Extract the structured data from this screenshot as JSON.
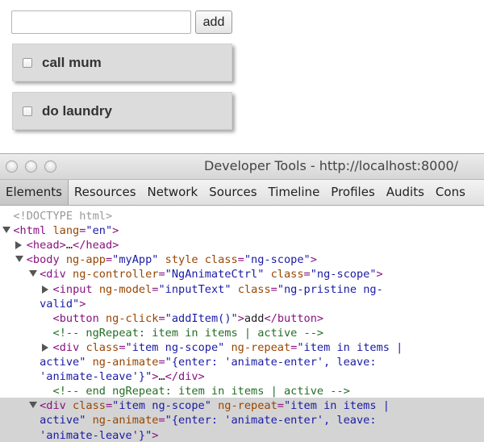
{
  "app": {
    "input": {
      "value": "",
      "placeholder": ""
    },
    "add_label": "add",
    "items": [
      {
        "label": "call mum",
        "checked": false
      },
      {
        "label": "do laundry",
        "checked": false
      }
    ]
  },
  "devtools": {
    "window_title": "Developer Tools - http://localhost:8000/",
    "tabs": [
      "Elements",
      "Resources",
      "Network",
      "Sources",
      "Timeline",
      "Profiles",
      "Audits",
      "Cons"
    ],
    "active_tab": "Elements",
    "tree": [
      {
        "indent": 2,
        "toggle": null,
        "parts": [
          [
            "c-doctype",
            "<!DOCTYPE html>"
          ]
        ]
      },
      {
        "indent": 2,
        "toggle": "down",
        "parts": [
          [
            "c-tag",
            "<html "
          ],
          [
            "c-attr",
            "lang"
          ],
          [
            "c-tag",
            "="
          ],
          [
            "c-val",
            "\"en\""
          ],
          [
            "c-tag",
            ">"
          ]
        ]
      },
      {
        "indent": 4,
        "toggle": "right",
        "parts": [
          [
            "c-tag",
            "<head>"
          ],
          [
            "c-text",
            "…"
          ],
          [
            "c-tag",
            "</head>"
          ]
        ]
      },
      {
        "indent": 4,
        "toggle": "down",
        "parts": [
          [
            "c-tag",
            "<body "
          ],
          [
            "c-attr",
            "ng-app"
          ],
          [
            "c-tag",
            "="
          ],
          [
            "c-val",
            "\"myApp\""
          ],
          [
            "c-tag",
            " "
          ],
          [
            "c-attr",
            "style class"
          ],
          [
            "c-tag",
            "="
          ],
          [
            "c-val",
            "\"ng-scope\""
          ],
          [
            "c-tag",
            ">"
          ]
        ]
      },
      {
        "indent": 6,
        "toggle": "down",
        "parts": [
          [
            "c-tag",
            "<div "
          ],
          [
            "c-attr",
            "ng-controller"
          ],
          [
            "c-tag",
            "="
          ],
          [
            "c-val",
            "\"NgAnimateCtrl\""
          ],
          [
            "c-tag",
            " "
          ],
          [
            "c-attr",
            "class"
          ],
          [
            "c-tag",
            "="
          ],
          [
            "c-val",
            "\"ng-scope\""
          ],
          [
            "c-tag",
            ">"
          ]
        ]
      },
      {
        "indent": 8,
        "toggle": "right",
        "parts": [
          [
            "c-tag",
            "<input "
          ],
          [
            "c-attr",
            "ng-model"
          ],
          [
            "c-tag",
            "="
          ],
          [
            "c-val",
            "\"inputText\""
          ],
          [
            "c-tag",
            " "
          ],
          [
            "c-attr",
            "class"
          ],
          [
            "c-tag",
            "="
          ],
          [
            "c-val",
            "\"ng-pristine ng-"
          ]
        ]
      },
      {
        "indent": 6,
        "toggle": null,
        "parts": [
          [
            "c-val",
            "valid\""
          ],
          [
            "c-tag",
            ">"
          ]
        ]
      },
      {
        "indent": 8,
        "toggle": null,
        "parts": [
          [
            "c-tag",
            "<button "
          ],
          [
            "c-attr",
            "ng-click"
          ],
          [
            "c-tag",
            "="
          ],
          [
            "c-val",
            "\"addItem()\""
          ],
          [
            "c-tag",
            ">"
          ],
          [
            "c-text",
            "add"
          ],
          [
            "c-tag",
            "</button>"
          ]
        ]
      },
      {
        "indent": 8,
        "toggle": null,
        "parts": [
          [
            "c-comment",
            "<!-- ngRepeat: item in items | active -->"
          ]
        ]
      },
      {
        "indent": 8,
        "toggle": "right",
        "parts": [
          [
            "c-tag",
            "<div "
          ],
          [
            "c-attr",
            "class"
          ],
          [
            "c-tag",
            "="
          ],
          [
            "c-val",
            "\"item ng-scope\""
          ],
          [
            "c-tag",
            " "
          ],
          [
            "c-attr",
            "ng-repeat"
          ],
          [
            "c-tag",
            "="
          ],
          [
            "c-val",
            "\"item in items |"
          ]
        ]
      },
      {
        "indent": 6,
        "toggle": null,
        "parts": [
          [
            "c-val",
            "active\""
          ],
          [
            "c-tag",
            " "
          ],
          [
            "c-attr",
            "ng-animate"
          ],
          [
            "c-tag",
            "="
          ],
          [
            "c-val",
            "\"{enter: 'animate-enter', leave:"
          ]
        ]
      },
      {
        "indent": 6,
        "toggle": null,
        "parts": [
          [
            "c-val",
            "'animate-leave'}\""
          ],
          [
            "c-tag",
            ">"
          ],
          [
            "c-text",
            "…"
          ],
          [
            "c-tag",
            "</div>"
          ]
        ]
      },
      {
        "indent": 8,
        "toggle": null,
        "parts": [
          [
            "c-comment",
            "<!-- end ngRepeat: item in items | active -->"
          ]
        ]
      },
      {
        "indent": 6,
        "toggle": "down",
        "highlight": true,
        "parts": [
          [
            "c-tag",
            "<div "
          ],
          [
            "c-attr",
            "class"
          ],
          [
            "c-tag",
            "="
          ],
          [
            "c-val",
            "\"item ng-scope\""
          ],
          [
            "c-tag",
            " "
          ],
          [
            "c-attr",
            "ng-repeat"
          ],
          [
            "c-tag",
            "="
          ],
          [
            "c-val",
            "\"item in items |"
          ]
        ]
      },
      {
        "indent": 6,
        "toggle": null,
        "highlight": true,
        "parts": [
          [
            "c-val",
            "active\""
          ],
          [
            "c-tag",
            " "
          ],
          [
            "c-attr",
            "ng-animate"
          ],
          [
            "c-tag",
            "="
          ],
          [
            "c-val",
            "\"{enter: 'animate-enter', leave:"
          ]
        ]
      },
      {
        "indent": 6,
        "toggle": null,
        "highlight": true,
        "parts": [
          [
            "c-val",
            "'animate-leave'}\""
          ],
          [
            "c-tag",
            ">"
          ]
        ]
      }
    ],
    "colors": {
      "tag": "#881280",
      "attr": "#994500",
      "value": "#1a1aa6",
      "comment": "#236e25",
      "doctype": "#999999",
      "selection": "#d4d4d4"
    }
  }
}
